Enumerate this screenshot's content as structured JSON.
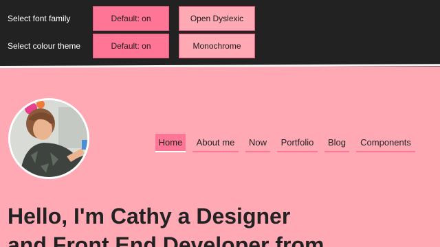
{
  "settings": {
    "font_family": {
      "label": "Select font family",
      "default_label": "Default: on",
      "alt_label": "Open Dyslexic"
    },
    "colour_theme": {
      "label": "Select colour theme",
      "default_label": "Default: on",
      "alt_label": "Monochrome"
    }
  },
  "colors": {
    "background": "#ffa9b5",
    "accent": "#ff7595",
    "bar": "#222222"
  },
  "nav": {
    "items": [
      {
        "label": "Home",
        "current": true
      },
      {
        "label": "About me"
      },
      {
        "label": "Now"
      },
      {
        "label": "Portfolio"
      },
      {
        "label": "Blog"
      },
      {
        "label": "Components"
      }
    ]
  },
  "hero": {
    "avatar_icon": "profile-photo",
    "line1": "Hello, I'm Cathy a Designer",
    "line2": "and Front End Developer from"
  }
}
